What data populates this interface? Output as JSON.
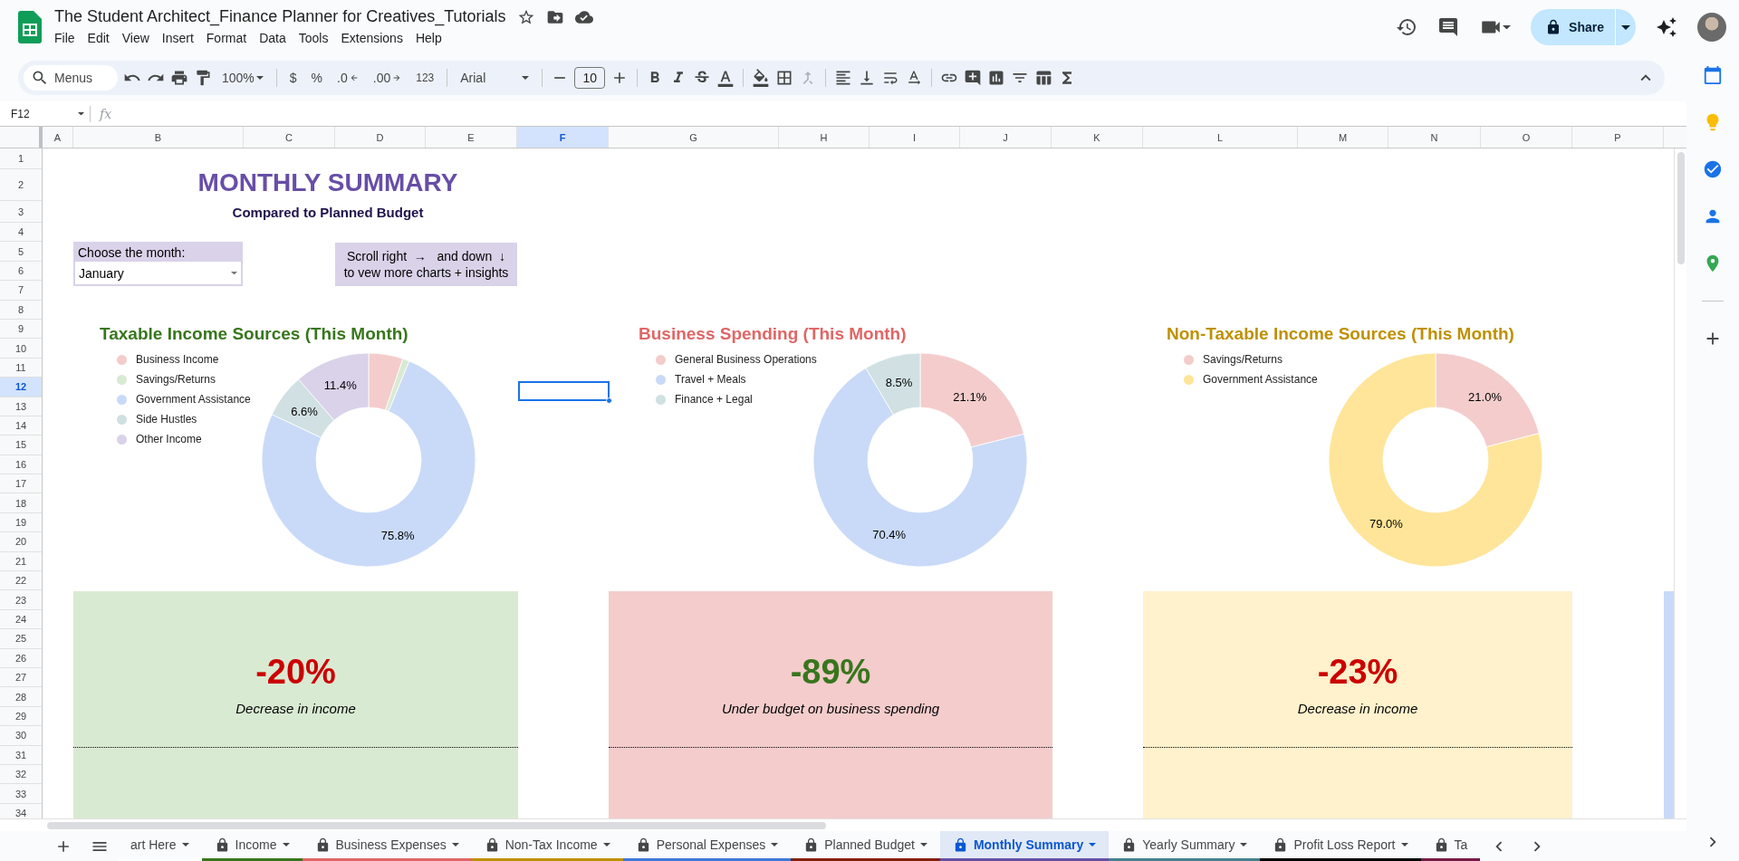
{
  "document": {
    "title": "The Student Architect_Finance Planner for Creatives_Tutorials"
  },
  "menu": [
    "File",
    "Edit",
    "View",
    "Insert",
    "Format",
    "Data",
    "Tools",
    "Extensions",
    "Help"
  ],
  "share": {
    "label": "Share"
  },
  "toolbar": {
    "search": {
      "placeholder": "Menus"
    },
    "zoom": "100%",
    "currency": "$",
    "percent": "%",
    "decrease_decimals": ".0",
    "increase_decimals": ".00",
    "number_format": "123",
    "font": "Arial",
    "font_size": "10"
  },
  "name_box": "F12",
  "formula_bar": {
    "label": "fx"
  },
  "columns": [
    {
      "label": "A",
      "selected": false
    },
    {
      "label": "B",
      "selected": false
    },
    {
      "label": "C",
      "selected": false
    },
    {
      "label": "D",
      "selected": false
    },
    {
      "label": "E",
      "selected": false
    },
    {
      "label": "F",
      "selected": true
    },
    {
      "label": "G",
      "selected": false
    },
    {
      "label": "H",
      "selected": false
    },
    {
      "label": "I",
      "selected": false
    },
    {
      "label": "J",
      "selected": false
    },
    {
      "label": "K",
      "selected": false
    },
    {
      "label": "L",
      "selected": false
    },
    {
      "label": "M",
      "selected": false
    },
    {
      "label": "N",
      "selected": false
    },
    {
      "label": "O",
      "selected": false
    },
    {
      "label": "P",
      "selected": false
    }
  ],
  "rows": [
    {
      "label": "1",
      "selected": false
    },
    {
      "label": "2",
      "selected": false
    },
    {
      "label": "3",
      "selected": false
    },
    {
      "label": "4",
      "selected": false
    },
    {
      "label": "5",
      "selected": false
    },
    {
      "label": "6",
      "selected": false
    },
    {
      "label": "7",
      "selected": false
    },
    {
      "label": "8",
      "selected": false
    },
    {
      "label": "9",
      "selected": false
    },
    {
      "label": "10",
      "selected": false
    },
    {
      "label": "11",
      "selected": false
    },
    {
      "label": "12",
      "selected": true
    },
    {
      "label": "13",
      "selected": false
    },
    {
      "label": "14",
      "selected": false
    },
    {
      "label": "15",
      "selected": false
    },
    {
      "label": "16",
      "selected": false
    },
    {
      "label": "17",
      "selected": false
    },
    {
      "label": "18",
      "selected": false
    },
    {
      "label": "19",
      "selected": false
    },
    {
      "label": "20",
      "selected": false
    },
    {
      "label": "21",
      "selected": false
    },
    {
      "label": "22",
      "selected": false
    },
    {
      "label": "23",
      "selected": false
    },
    {
      "label": "24",
      "selected": false
    },
    {
      "label": "25",
      "selected": false
    },
    {
      "label": "26",
      "selected": false
    },
    {
      "label": "27",
      "selected": false
    },
    {
      "label": "28",
      "selected": false
    },
    {
      "label": "29",
      "selected": false
    },
    {
      "label": "30",
      "selected": false
    },
    {
      "label": "31",
      "selected": false
    },
    {
      "label": "32",
      "selected": false
    },
    {
      "label": "33",
      "selected": false
    },
    {
      "label": "34",
      "selected": false
    }
  ],
  "sheet": {
    "title": "MONTHLY SUMMARY",
    "subtitle": "Compared to Planned Budget",
    "month_picker": {
      "label": "Choose the month:",
      "value": "January"
    },
    "note": "Scroll right  →   and down  ↓\nto vew more charts + insights",
    "charts": [
      {
        "color": "#38761d",
        "legend": [
          {
            "color": "#f4cccc"
          },
          {
            "color": "#d9ead3"
          },
          {
            "color": "#c9daf8"
          },
          {
            "color": "#d0e0e3"
          },
          {
            "color": "#d9d2e9"
          }
        ],
        "chart_data": {
          "type": "donut",
          "title": "Taxable Income Sources (This Month)",
          "categories": [
            "Business Income",
            "Savings/Returns",
            "Government Assistance",
            "Side Hustles",
            "Other Income"
          ],
          "values": [
            5.2,
            1.0,
            75.8,
            6.6,
            11.4
          ],
          "value_labels": [
            null,
            null,
            "75.8%",
            "6.6%",
            "11.4%"
          ]
        }
      },
      {
        "color": "#e06666",
        "legend": [
          {
            "color": "#f4cccc"
          },
          {
            "color": "#c9daf8"
          },
          {
            "color": "#d0e0e3"
          }
        ],
        "chart_data": {
          "type": "donut",
          "title": "Business Spending (This Month)",
          "categories": [
            "General Business Operations",
            "Travel + Meals",
            "Finance + Legal"
          ],
          "values": [
            21.1,
            70.4,
            8.5
          ],
          "value_labels": [
            "21.1%",
            "70.4%",
            "8.5%"
          ]
        }
      },
      {
        "color": "#bf9000",
        "legend": [
          {
            "color": "#f4cccc"
          },
          {
            "color": "#ffe599"
          }
        ],
        "chart_data": {
          "type": "donut",
          "title": "Non-Taxable Income Sources (This Month)",
          "categories": [
            "Savings/Returns",
            "Government Assistance"
          ],
          "values": [
            21.0,
            79.0
          ],
          "value_labels": [
            "21.0%",
            "79.0%"
          ]
        }
      }
    ],
    "cards": [
      {
        "value": "-20%",
        "caption": "Decrease in income",
        "color": "#d9ead3",
        "unfavorable": true
      },
      {
        "value": "-89%",
        "caption": "Under budget on business spending",
        "color": "#f4cccc",
        "unfavorable": false
      },
      {
        "value": "-23%",
        "caption": "Decrease in income",
        "color": "#fff2cc",
        "unfavorable": true
      },
      {
        "color": "#c9daf8"
      }
    ]
  },
  "sheet_tabs": [
    {
      "label": "art Here",
      "locked": false,
      "selected": false,
      "color": "#ffffff"
    },
    {
      "label": "Income",
      "locked": true,
      "selected": false,
      "color": "#38761d"
    },
    {
      "label": "Business Expenses",
      "locked": true,
      "selected": false,
      "color": "#e06666"
    },
    {
      "label": "Non-Tax Income",
      "locked": true,
      "selected": false,
      "color": "#bf9000"
    },
    {
      "label": "Personal Expenses",
      "locked": true,
      "selected": false,
      "color": "#3c78d8"
    },
    {
      "label": "Planned Budget",
      "locked": true,
      "selected": false,
      "color": "#85200c"
    },
    {
      "label": "Monthly Summary",
      "locked": true,
      "selected": true,
      "color": "#674ea7"
    },
    {
      "label": "Yearly Summary",
      "locked": true,
      "selected": false,
      "color": "#45818e"
    },
    {
      "label": "Profit Loss Report",
      "locked": true,
      "selected": false,
      "color": "#000000"
    },
    {
      "label": "Ta",
      "locked": true,
      "selected": false,
      "color": "#741b47"
    }
  ]
}
